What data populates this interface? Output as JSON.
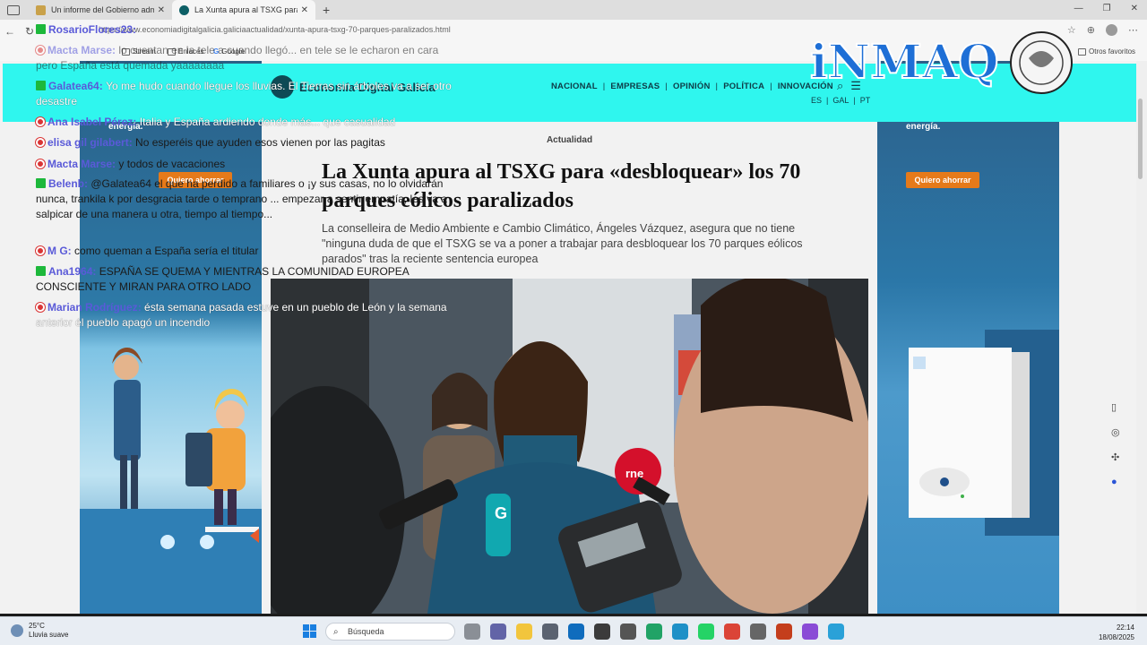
{
  "browser": {
    "tabs": [
      {
        "title": "Un informe del Gobierno admite",
        "active": false
      },
      {
        "title": "La Xunta apura al TSXG para «des",
        "active": true
      }
    ],
    "url": "https://www.economiadigitalgalicia.galiciaactualidad/xunta-apura-tsxg-70-parques-paralizados.html",
    "bookmarks": [
      "Stream",
      "Enlaces",
      "Google"
    ],
    "other_bookmarks": "Otros favoritos"
  },
  "site": {
    "name": "Economía Digital Galicia",
    "nav": [
      "NACIONAL",
      "EMPRESAS",
      "OPINIÓN",
      "POLÍTICA",
      "INNOVACIÓN"
    ],
    "languages": [
      "ES",
      "GAL",
      "PT"
    ]
  },
  "article": {
    "section": "Actualidad",
    "headline": "La Xunta apura al TSXG para «desbloquear» los 70 parques eólicos paralizados",
    "lead": "La conselleira de Medio Ambiente e Cambio Climático, Ángeles Vázquez, asegura que no tiene \"ninguna duda de que el TSXG se va a poner a trabajar para desbloquear los 70 parques eólicos parados\" tras la reciente sentencia europea"
  },
  "ads": {
    "left_text": "energía.",
    "left_button": "Quiero ahorrar",
    "right_text": "energía.",
    "right_button": "Quiero ahorrar"
  },
  "chat": [
    {
      "user": "RosarioFlores23",
      "badge": "green",
      "text": ""
    },
    {
      "user": "Macta Marse",
      "badge": "red",
      "text": "lo cuentan en la tele a cuando llegó... en tele se le echaron en cara pero España está quemada yaaaaaaaa"
    },
    {
      "user": "Galatea64",
      "badge": "green",
      "text": "Yo me hudo cuando llegue los lluvias. El Tierras sin árboles va a ser otro desastre"
    },
    {
      "user": "Ana Isabel Pérez",
      "badge": "red",
      "text": "Italia y España ardiendo donde más... que casualidad"
    },
    {
      "user": "elisa gil gilabert",
      "badge": "red",
      "text": "No esperéis que ayuden esos vienen por las pagitas"
    },
    {
      "user": "Macta Marse",
      "badge": "red",
      "text": "y todos de vacaciones"
    },
    {
      "user": "Belenb",
      "badge": "green",
      "text": "@Galatea64 el que ha perdido a familiares o ¡y sus casas, no lo olvidarán nunca, trankila k por desgracia tarde o temprano ... empezar a sentir empatía, les va a salpicar de una manera u otra, tiempo al tiempo..."
    },
    {
      "user": "M G",
      "badge": "red",
      "text": "como queman a España sería el titular"
    },
    {
      "user": "Ana1964",
      "badge": "green",
      "text": "ESPAÑA SE QUEMA Y MIENTRAS LA COMUNIDAD EUROPEA CONSCIENTE Y MIRAN PARA OTRO LADO"
    },
    {
      "user": "Marian Rodríguez",
      "badge": "red",
      "text": "ésta semana pasada estuve en un pueblo de León y la semana anterior él pueblo apagó un incendio"
    }
  ],
  "watermark": "iNMAQ",
  "taskbar": {
    "weather_temp": "25°C",
    "weather_desc": "Lluvia suave",
    "search_placeholder": "Búsqueda",
    "time": "22:14",
    "date": "18/08/2025"
  }
}
